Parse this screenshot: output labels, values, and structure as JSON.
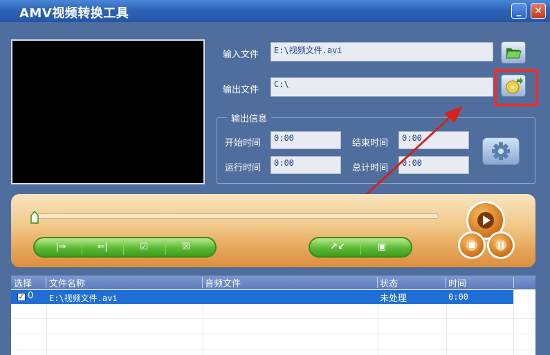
{
  "window": {
    "title": "AMV视频转换工具"
  },
  "files": {
    "input_label": "输入文件",
    "input_value": "E:\\视频文件.avi",
    "output_label": "输出文件",
    "output_value": "C:\\"
  },
  "output_info": {
    "group_label": "输出信息",
    "start_label": "开始时间",
    "start_value": "0:00",
    "end_label": "结束时间",
    "end_value": "0:00",
    "run_label": "运行时间",
    "run_value": "0:00",
    "total_label": "总计时间",
    "total_value": "0:00"
  },
  "player": {
    "progress": 0
  },
  "table": {
    "columns": [
      "选择",
      "文件名称",
      "音频文件",
      "状态",
      "时间"
    ],
    "rows": [
      {
        "index": "0",
        "checked": true,
        "name": "E:\\视频文件.avi",
        "audio": "",
        "status": "未处理",
        "time": "0:00"
      }
    ]
  },
  "colors": {
    "highlight": "#e8312a",
    "row_selected": "#1e6ed6"
  },
  "icons": [
    "folder-open-icon",
    "cd-save-icon",
    "gear-icon",
    "play-icon",
    "stop-icon",
    "pause-icon"
  ]
}
